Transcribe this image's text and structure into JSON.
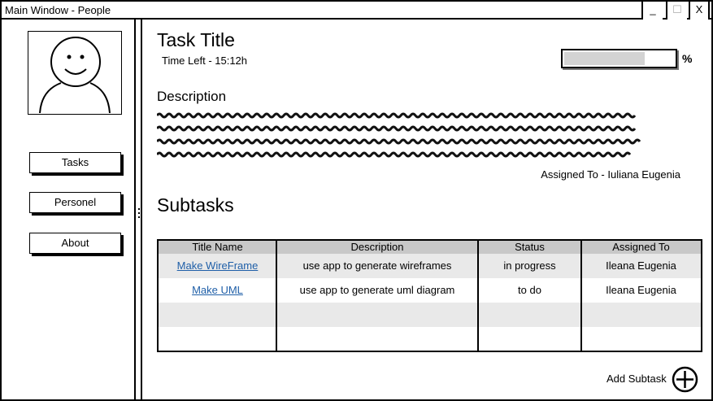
{
  "window": {
    "title": "Main Window - People",
    "minimize": "_",
    "maximize": "☐",
    "close": "X"
  },
  "sidebar": {
    "items": [
      {
        "label": "Tasks"
      },
      {
        "label": "Personel"
      },
      {
        "label": "About"
      }
    ]
  },
  "task": {
    "title": "Task Title",
    "time_left": "Time Left - 15:12h",
    "progress": 0.73,
    "progress_unit": "%",
    "description_heading": "Description",
    "assigned_to": "Assigned To - Iuliana Eugenia"
  },
  "subtasks": {
    "heading": "Subtasks",
    "columns": [
      "Title Name",
      "Description",
      "Status",
      "Assigned To"
    ],
    "rows": [
      {
        "title": "Make WireFrame",
        "description": "use app to generate wireframes",
        "status": "in progress",
        "assigned": "Ileana Eugenia"
      },
      {
        "title": "Make UML",
        "description": "use app to generate uml diagram",
        "status": "to do",
        "assigned": "Ileana Eugenia"
      }
    ],
    "add_label": "Add Subtask"
  },
  "icons": {
    "add": "plus-circle-icon",
    "avatar": "person-avatar-icon"
  }
}
